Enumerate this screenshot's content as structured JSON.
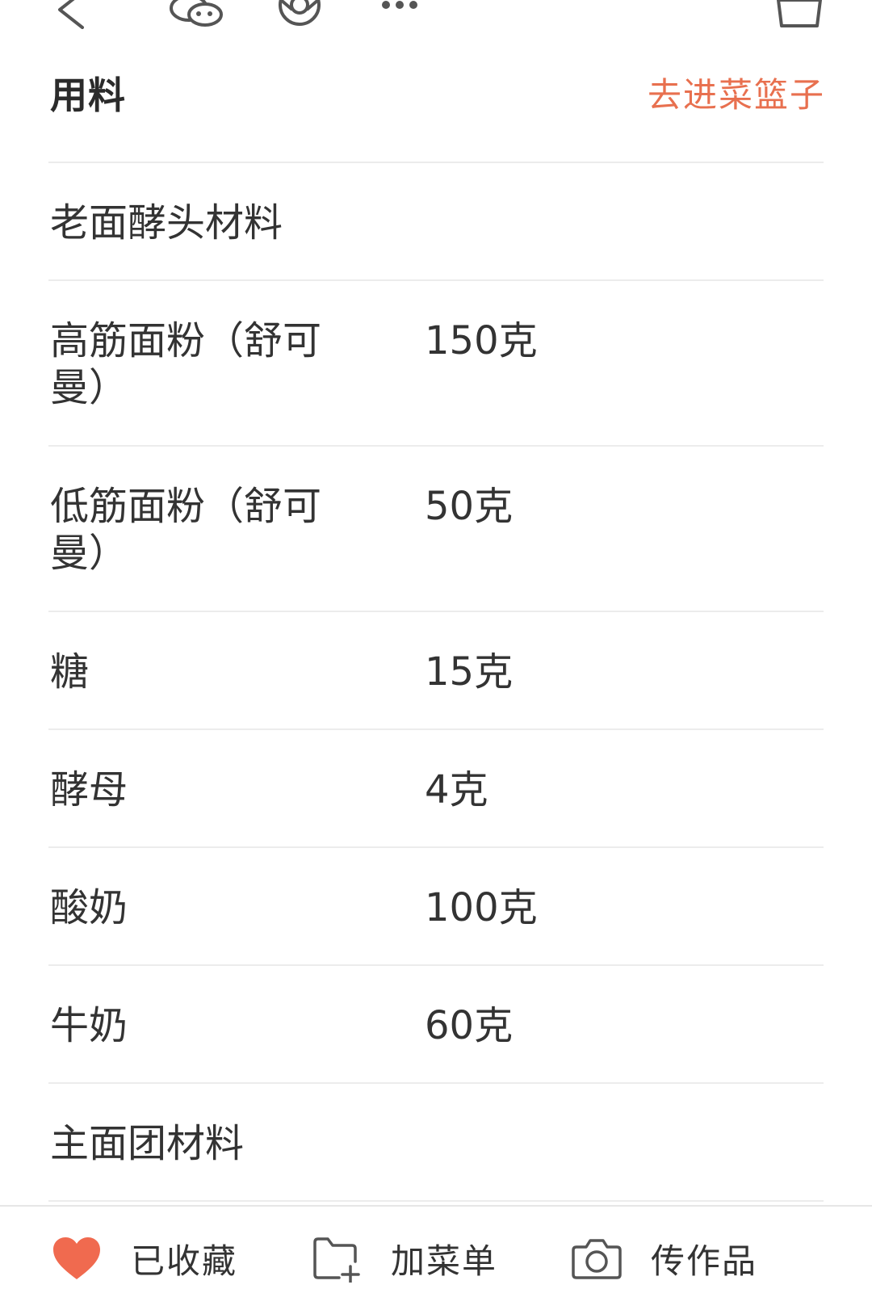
{
  "toolbar": {
    "icons": [
      "back-icon",
      "wechat-icon",
      "moments-icon",
      "more-icon",
      "basket-icon"
    ]
  },
  "section": {
    "title": "用料",
    "basket_link": "去进菜篮子"
  },
  "ingredients": [
    {
      "name": "老面酵头材料",
      "qty": ""
    },
    {
      "name": "高筋面粉（舒可曼）",
      "qty": "150克"
    },
    {
      "name": "低筋面粉（舒可曼）",
      "qty": "50克"
    },
    {
      "name": "糖",
      "qty": "15克"
    },
    {
      "name": "酵母",
      "qty": "4克"
    },
    {
      "name": "酸奶",
      "qty": "100克"
    },
    {
      "name": "牛奶",
      "qty": "60克"
    },
    {
      "name": "主面团材料",
      "qty": ""
    }
  ],
  "bottom_bar": {
    "collect": {
      "label": "已收藏",
      "icon": "heart-icon"
    },
    "add_menu": {
      "label": "加菜单",
      "icon": "folder-add-icon"
    },
    "upload": {
      "label": "传作品",
      "icon": "camera-icon"
    }
  },
  "colors": {
    "accent": "#e8704f",
    "heart": "#f06a4f",
    "text": "#333333",
    "divider": "#ececec"
  }
}
